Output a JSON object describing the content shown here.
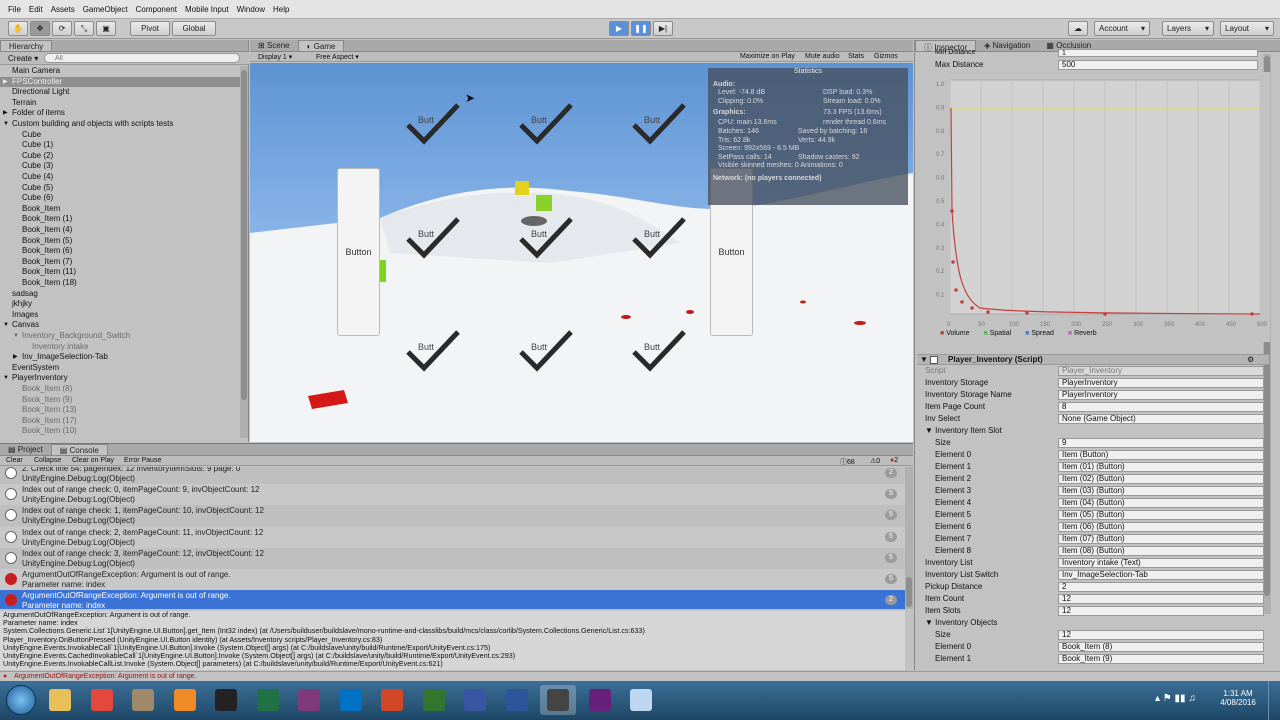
{
  "menu": [
    "File",
    "Edit",
    "Assets",
    "GameObject",
    "Component",
    "Mobile Input",
    "Window",
    "Help"
  ],
  "toolbar": {
    "pivot": "Pivot",
    "global": "Global",
    "account": "Account",
    "layers": "Layers",
    "layout": "Layout"
  },
  "hierarchy": {
    "tab": "Hierarchy",
    "create": "Create",
    "search_placeholder": "All",
    "items": [
      {
        "label": "Main Camera",
        "indent": 0,
        "style": ""
      },
      {
        "label": "FPSController",
        "indent": 0,
        "style": "sel",
        "arrow": "▶"
      },
      {
        "label": "Directional Light",
        "indent": 0,
        "style": ""
      },
      {
        "label": "Terrain",
        "indent": 0,
        "style": ""
      },
      {
        "label": "Folder of items",
        "indent": 0,
        "style": "",
        "arrow": "▶"
      },
      {
        "label": "Custom building and objects with scripts tests",
        "indent": 0,
        "style": "",
        "arrow": "▼"
      },
      {
        "label": "Cube",
        "indent": 1,
        "style": ""
      },
      {
        "label": "Cube (1)",
        "indent": 1,
        "style": ""
      },
      {
        "label": "Cube (2)",
        "indent": 1,
        "style": ""
      },
      {
        "label": "Cube (3)",
        "indent": 1,
        "style": ""
      },
      {
        "label": "Cube (4)",
        "indent": 1,
        "style": ""
      },
      {
        "label": "Cube (5)",
        "indent": 1,
        "style": ""
      },
      {
        "label": "Cube (6)",
        "indent": 1,
        "style": ""
      },
      {
        "label": "Book_Item",
        "indent": 1,
        "style": ""
      },
      {
        "label": "Book_Item (1)",
        "indent": 1,
        "style": ""
      },
      {
        "label": "Book_Item (4)",
        "indent": 1,
        "style": ""
      },
      {
        "label": "Book_Item (5)",
        "indent": 1,
        "style": ""
      },
      {
        "label": "Book_Item (6)",
        "indent": 1,
        "style": ""
      },
      {
        "label": "Book_Item (7)",
        "indent": 1,
        "style": ""
      },
      {
        "label": "Book_Item (11)",
        "indent": 1,
        "style": ""
      },
      {
        "label": "Book_Item (18)",
        "indent": 1,
        "style": ""
      },
      {
        "label": "sadsag",
        "indent": 0,
        "style": ""
      },
      {
        "label": "jkhjky",
        "indent": 0,
        "style": ""
      },
      {
        "label": "Images",
        "indent": 0,
        "style": ""
      },
      {
        "label": "Canvas",
        "indent": 0,
        "style": "",
        "arrow": "▼"
      },
      {
        "label": "Inventory_Background_Switch",
        "indent": 1,
        "style": "dim",
        "arrow": "▼"
      },
      {
        "label": "Inventory intake",
        "indent": 2,
        "style": "dim"
      },
      {
        "label": "Inv_ImageSelection-Tab",
        "indent": 1,
        "style": "",
        "arrow": "▶"
      },
      {
        "label": "EventSystem",
        "indent": 0,
        "style": ""
      },
      {
        "label": "PlayerInventory",
        "indent": 0,
        "style": "",
        "arrow": "▼"
      },
      {
        "label": "Book_Item (8)",
        "indent": 1,
        "style": "dim"
      },
      {
        "label": "Book_Item (9)",
        "indent": 1,
        "style": "dim"
      },
      {
        "label": "Book_Item (13)",
        "indent": 1,
        "style": "dim"
      },
      {
        "label": "Book_Item (17)",
        "indent": 1,
        "style": "dim"
      },
      {
        "label": "Book_Item (10)",
        "indent": 1,
        "style": "dim"
      }
    ]
  },
  "scene": {
    "tabs": [
      "Scene",
      "Game"
    ],
    "display": "Display 1",
    "aspect": "Free Aspect",
    "options": [
      "Maximize on Play",
      "Mute audio",
      "Stats",
      "Gizmos"
    ],
    "button_label": "Button",
    "check_label": "Butt",
    "stats": {
      "title": "Statistics",
      "audio": "Audio:",
      "audio_l1a": "Level: -74.8 dB",
      "audio_l1b": "DSP load: 0.3%",
      "audio_l2a": "Clipping: 0.0%",
      "audio_l2b": "Stream load: 0.0%",
      "graphics": "Graphics:",
      "fps": "73.3 FPS (13.6ms)",
      "g1a": "CPU: main 13.6ms",
      "g1b": "render thread 0.6ms",
      "g2a": "Batches: 146",
      "g2b": "Saved by batching: 18",
      "g3a": "Tris: 62.8k",
      "g3b": "Verts: 44.9k",
      "g4": "Screen: 992x569 - 6.5 MB",
      "g5a": "SetPass calls: 14",
      "g5b": "Shadow casters: 92",
      "g6": "Visible skinned meshes: 0  Animations: 0",
      "network": "Network: (no players connected)"
    }
  },
  "console": {
    "tabs": [
      "Project",
      "Console"
    ],
    "buttons": [
      "Clear",
      "Collapse",
      "Clear on Play",
      "Error Pause"
    ],
    "counts": {
      "info": "68",
      "warn": "0",
      "error": "2"
    },
    "rows": [
      {
        "l1": "2. Check line 54: pageIndex: 12  inventoryItemSlots: 9  page: 0",
        "l2": "UnityEngine.Debug:Log(Object)",
        "count": "2",
        "type": "info"
      },
      {
        "l1": "Index out of range check:   0,      itemPageCount:  9,      invObjectCount:  12",
        "l2": "UnityEngine.Debug:Log(Object)",
        "count": "5",
        "type": "info"
      },
      {
        "l1": "Index out of range check:   1,      itemPageCount:  10,     invObjectCount:  12",
        "l2": "UnityEngine.Debug:Log(Object)",
        "count": "5",
        "type": "info"
      },
      {
        "l1": "Index out of range check:   2,      itemPageCount:  11,     invObjectCount:  12",
        "l2": "UnityEngine.Debug:Log(Object)",
        "count": "5",
        "type": "info"
      },
      {
        "l1": "Index out of range check:   3,      itemPageCount:  12,     invObjectCount:  12",
        "l2": "UnityEngine.Debug:Log(Object)",
        "count": "5",
        "type": "info"
      },
      {
        "l1": "ArgumentOutOfRangeException: Argument is out of range.",
        "l2": "Parameter name: index",
        "count": "5",
        "type": "err"
      },
      {
        "l1": "ArgumentOutOfRangeException: Argument is out of range.",
        "l2": "Parameter name: index",
        "count": "2",
        "type": "err",
        "sel": true
      }
    ],
    "detail": [
      "ArgumentOutOfRangeException: Argument is out of range.",
      "Parameter name: index",
      "System.Collections.Generic.List`1[UnityEngine.UI.Button].get_Item (Int32 index) (at /Users/builduser/buildslave/mono-runtime-and-classlibs/build/mcs/class/corlib/System.Collections.Generic/List.cs:633)",
      "Player_Inventory.OnButtonPressed (UnityEngine.UI.Button identity) (at Assets/Inventory scripts/Player_Inventory.cs:83)",
      "UnityEngine.Events.InvokableCall`1[UnityEngine.UI.Button].Invoke (System.Object[] args) (at C:/buildslave/unity/build/Runtime/Export/UnityEvent.cs:175)",
      "UnityEngine.Events.CachedInvokableCall`1[UnityEngine.UI.Button].Invoke (System.Object[] args) (at C:/buildslave/unity/build/Runtime/Export/UnityEvent.cs:293)",
      "UnityEngine.Events.InvokableCallList.Invoke (System.Object[] parameters) (at C:/buildslave/unity/build/Runtime/Export/UnityEvent.cs:621)"
    ],
    "status": "ArgumentOutOfRangeException: Argument is out of range."
  },
  "inspector": {
    "tabs": [
      "Inspector",
      "Navigation",
      "Occlusion"
    ],
    "min_distance_label": "Min Distance",
    "min_distance": "1",
    "max_distance_label": "Max Distance",
    "max_distance": "500",
    "graph_legend": [
      "Volume",
      "Spatial",
      "Spread",
      "Reverb"
    ],
    "graph_xticks": [
      "0",
      "50",
      "100",
      "150",
      "200",
      "250",
      "300",
      "350",
      "400",
      "450",
      "500"
    ],
    "graph_yticks": [
      "1.0",
      "0.9",
      "0.8",
      "0.7",
      "0.6",
      "0.5",
      "0.4",
      "0.3",
      "0.2",
      "0.1"
    ],
    "component": "Player_Inventory (Script)",
    "fields": [
      {
        "label": "Script",
        "value": "Player_Inventory",
        "dim": true
      },
      {
        "label": "Inventory Storage",
        "value": "PlayerInventory"
      },
      {
        "label": "Inventory Storage Name",
        "value": "PlayerInventory"
      },
      {
        "label": "Item Page Count",
        "value": "8"
      },
      {
        "label": "Inv Select",
        "value": "None (Game Object)"
      },
      {
        "label": "▼ Inventory Item Slot",
        "value": "",
        "plain": true
      },
      {
        "label": "Size",
        "value": "9",
        "indent": true
      },
      {
        "label": "Element 0",
        "value": "Item (Button)",
        "indent": true
      },
      {
        "label": "Element 1",
        "value": "Item (01) (Button)",
        "indent": true
      },
      {
        "label": "Element 2",
        "value": "Item (02) (Button)",
        "indent": true
      },
      {
        "label": "Element 3",
        "value": "Item (03) (Button)",
        "indent": true
      },
      {
        "label": "Element 4",
        "value": "Item (04) (Button)",
        "indent": true
      },
      {
        "label": "Element 5",
        "value": "Item (05) (Button)",
        "indent": true
      },
      {
        "label": "Element 6",
        "value": "Item (06) (Button)",
        "indent": true
      },
      {
        "label": "Element 7",
        "value": "Item (07) (Button)",
        "indent": true
      },
      {
        "label": "Element 8",
        "value": "Item (08) (Button)",
        "indent": true
      },
      {
        "label": "Inventory List",
        "value": "Inventory intake (Text)"
      },
      {
        "label": "Inventory List Switch",
        "value": "Inv_ImageSelection-Tab"
      },
      {
        "label": "Pickup Distance",
        "value": "2"
      },
      {
        "label": "Item Count",
        "value": "12"
      },
      {
        "label": "Item Slots",
        "value": "12"
      },
      {
        "label": "▼ Inventory Objects",
        "value": "",
        "plain": true
      },
      {
        "label": "Size",
        "value": "12",
        "indent": true
      },
      {
        "label": "Element 0",
        "value": "Book_Item (8)",
        "indent": true
      },
      {
        "label": "Element 1",
        "value": "Book_Item (9)",
        "indent": true
      }
    ]
  },
  "taskbar": {
    "apps": [
      {
        "name": "explorer-icon",
        "color": "#e8c05a"
      },
      {
        "name": "chrome-icon",
        "color": "#e2483b"
      },
      {
        "name": "pyramid-icon",
        "color": "#a0896a"
      },
      {
        "name": "media-icon",
        "color": "#f08a25"
      },
      {
        "name": "unity-dark-icon",
        "color": "#222222"
      },
      {
        "name": "excel-icon",
        "color": "#207245"
      },
      {
        "name": "onenote-icon",
        "color": "#80397b"
      },
      {
        "name": "outlook-icon",
        "color": "#0072c6"
      },
      {
        "name": "powerpoint-icon",
        "color": "#d24726"
      },
      {
        "name": "project-icon",
        "color": "#31752f"
      },
      {
        "name": "visio-icon",
        "color": "#3955a3"
      },
      {
        "name": "word-icon",
        "color": "#2b579a"
      },
      {
        "name": "unity-icon",
        "color": "#444444"
      },
      {
        "name": "visual-studio-icon",
        "color": "#68217a"
      },
      {
        "name": "paint-icon",
        "color": "#bcd7ef"
      }
    ],
    "time": "1:31 AM",
    "date": "4/08/2016"
  }
}
